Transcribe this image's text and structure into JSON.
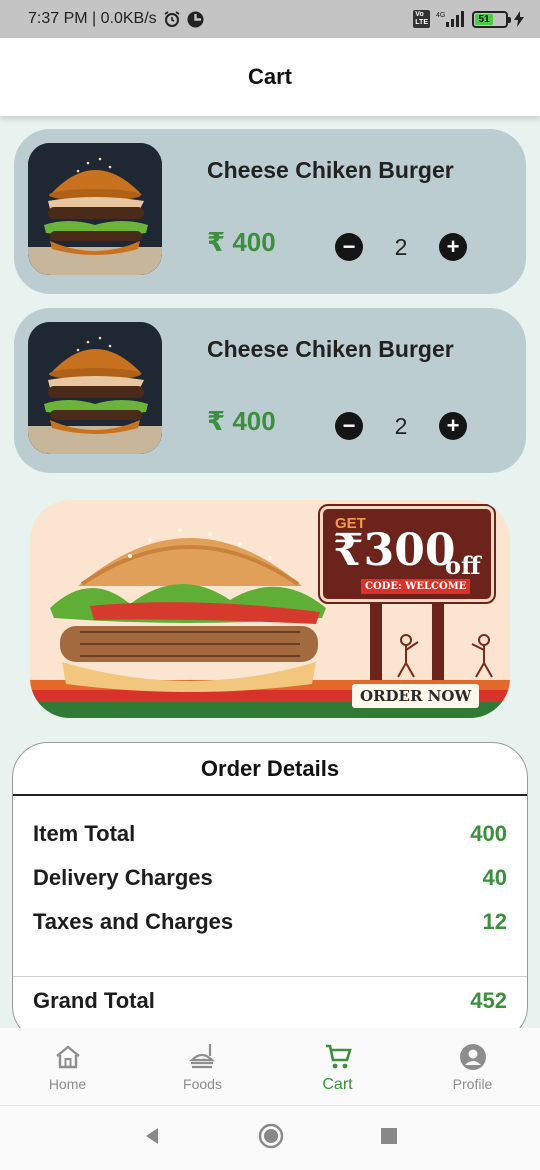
{
  "status_bar": {
    "time_speed": "7:37 PM | 0.0KB/s",
    "network": "4G",
    "battery": "51"
  },
  "app_bar": {
    "title": "Cart"
  },
  "cart_items": [
    {
      "name": "Cheese Chiken Burger",
      "price": "₹ 400",
      "quantity": "2"
    },
    {
      "name": "Cheese Chiken Burger",
      "price": "₹ 400",
      "quantity": "2"
    }
  ],
  "promo_banner": {
    "get": "GET",
    "amount": "₹300",
    "off": "off",
    "code": "CODE: WELCOME",
    "cta": "ORDER NOW"
  },
  "order_details": {
    "title": "Order Details",
    "item_total_label": "Item Total",
    "item_total_value": "400",
    "delivery_label": "Delivery Charges",
    "delivery_value": "40",
    "taxes_label": "Taxes and Charges",
    "taxes_value": "12",
    "grand_total_label": "Grand Total",
    "grand_total_value": "452"
  },
  "bottom_nav": {
    "items": [
      {
        "label": "Home",
        "icon": "home-icon"
      },
      {
        "label": "Foods",
        "icon": "foods-icon"
      },
      {
        "label": "Cart",
        "icon": "cart-icon"
      },
      {
        "label": "Profile",
        "icon": "profile-icon"
      }
    ],
    "active": "Cart"
  },
  "colors": {
    "accent_green": "#3b8f3e",
    "card_bg": "#bccdd2",
    "page_bg": "#e8f3ef"
  }
}
